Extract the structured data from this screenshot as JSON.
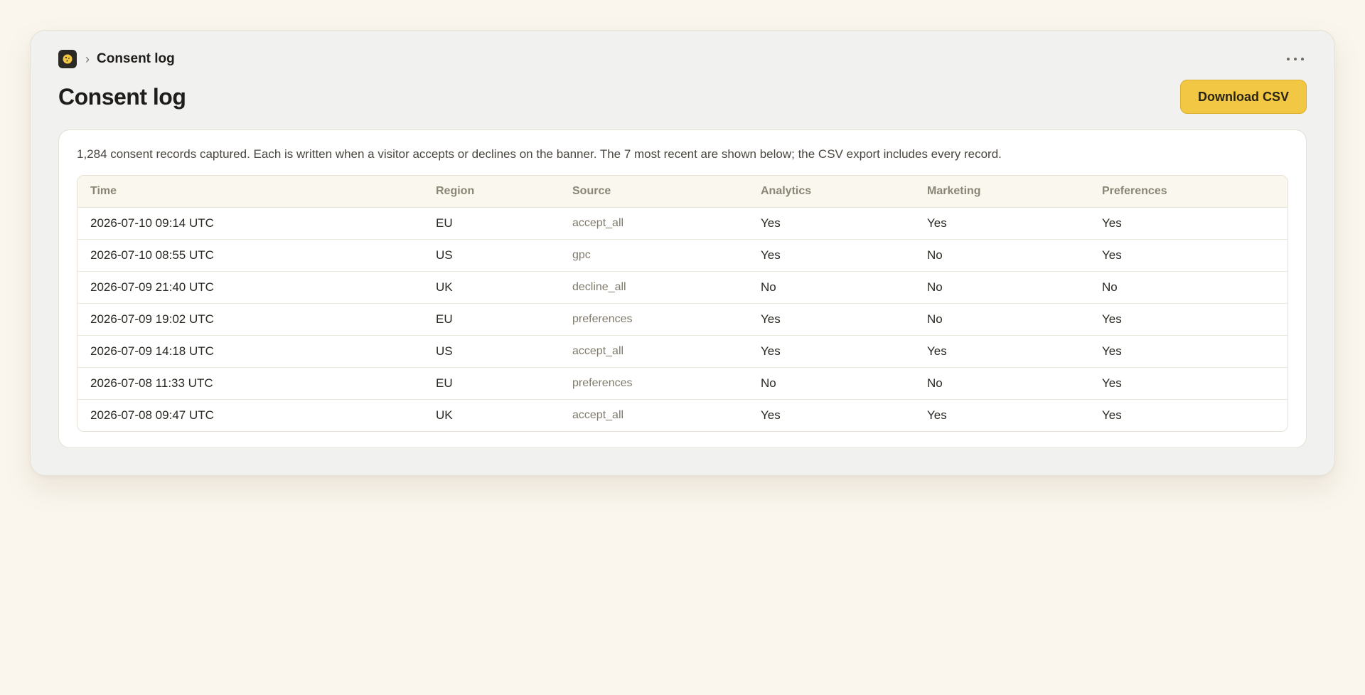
{
  "breadcrumb": {
    "icon": "cookie-icon",
    "separator": "›",
    "current": "Consent log"
  },
  "header": {
    "title": "Consent log",
    "download_label": "Download CSV",
    "more_icon": "more-horizontal-icon"
  },
  "summary": "1,284 consent records captured. Each is written when a visitor accepts or declines on the banner. The 7 most recent are shown below; the CSV export includes every record.",
  "table": {
    "columns": [
      "Time",
      "Region",
      "Source",
      "Analytics",
      "Marketing",
      "Preferences"
    ],
    "rows": [
      [
        "2026-07-10 09:14 UTC",
        "EU",
        "accept_all",
        "Yes",
        "Yes",
        "Yes"
      ],
      [
        "2026-07-10 08:55 UTC",
        "US",
        "gpc",
        "Yes",
        "No",
        "Yes"
      ],
      [
        "2026-07-09 21:40 UTC",
        "UK",
        "decline_all",
        "No",
        "No",
        "No"
      ],
      [
        "2026-07-09 19:02 UTC",
        "EU",
        "preferences",
        "Yes",
        "No",
        "Yes"
      ],
      [
        "2026-07-09 14:18 UTC",
        "US",
        "accept_all",
        "Yes",
        "Yes",
        "Yes"
      ],
      [
        "2026-07-08 11:33 UTC",
        "EU",
        "preferences",
        "No",
        "No",
        "Yes"
      ],
      [
        "2026-07-08 09:47 UTC",
        "UK",
        "accept_all",
        "Yes",
        "Yes",
        "Yes"
      ]
    ]
  },
  "colors": {
    "accent": "#f2c744",
    "background": "#faf6ee",
    "panel": "#f1f1f0"
  }
}
